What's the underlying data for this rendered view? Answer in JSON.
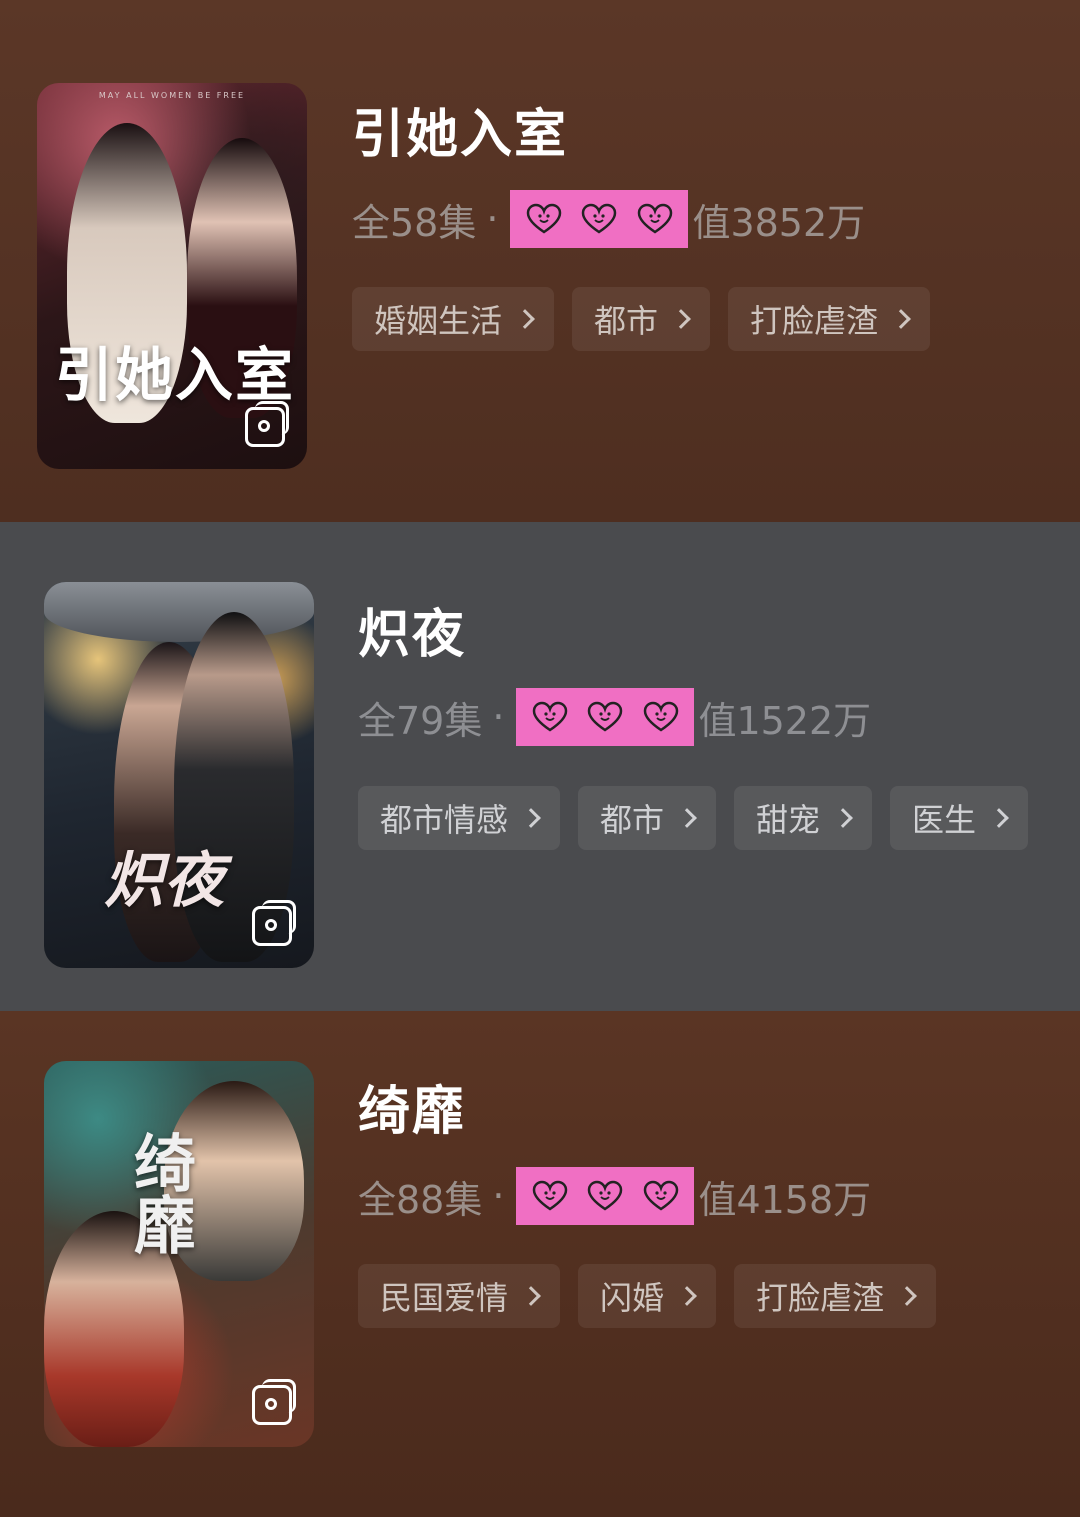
{
  "dramas": [
    {
      "title": "引她入室",
      "poster_text": "引她入室",
      "poster_tagline": "MAY ALL WOMEN BE FREE",
      "episodes": "全58集",
      "separator": "·",
      "stat": "值3852万",
      "tags": [
        "婚姻生活",
        "都市",
        "打脸虐渣"
      ]
    },
    {
      "title": "炽夜",
      "poster_text": "炽夜",
      "episodes": "全79集",
      "separator": "·",
      "stat": "值1522万",
      "tags": [
        "都市情感",
        "都市",
        "甜宠",
        "医生"
      ]
    },
    {
      "title": "绮靡",
      "poster_text": "绮靡",
      "episodes": "全88集",
      "separator": "·",
      "stat": "值4158万",
      "tags": [
        "民国爱情",
        "闪婚",
        "打脸虐渣"
      ]
    }
  ],
  "sticker_color": "#f06fc3",
  "icons": {
    "poster_badge": "gallery-icon",
    "tag_arrow": "chevron-right-icon",
    "sticker": "heart-face-icon"
  },
  "colors": {
    "card_brown": "#5b3727",
    "card_gray": "#4a4b4e",
    "title": "#ffffff",
    "meta": "#9a8f8a"
  }
}
